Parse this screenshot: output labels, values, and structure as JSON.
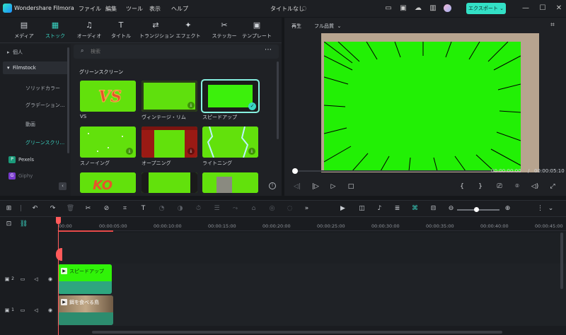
{
  "app": {
    "name": "Wondershare Filmora",
    "menu": [
      "ファイル",
      "編集",
      "ツール",
      "表示",
      "ヘルプ"
    ],
    "project_title": "タイトルなし",
    "export_label": "エクスポート",
    "accent": "#33e0c6"
  },
  "media": {
    "tabs": [
      {
        "label": "メディア",
        "icon": "media-icon"
      },
      {
        "label": "ストック",
        "icon": "stock-icon"
      },
      {
        "label": "オーディオ",
        "icon": "music-note-icon"
      },
      {
        "label": "タイトル",
        "icon": "title-icon"
      },
      {
        "label": "トランジション",
        "icon": "transition-icon"
      },
      {
        "label": "エフェクト",
        "icon": "effect-icon"
      },
      {
        "label": "ステッカー",
        "icon": "sticker-icon"
      },
      {
        "label": "テンプレート",
        "icon": "template-icon"
      }
    ],
    "sidebar": {
      "personal": "個人",
      "filmstock": "Filmstock",
      "sub_items": [
        "ソリッドカラー",
        "グラデーション...",
        "動画",
        "グリーンスクリ..."
      ],
      "pexels": "Pexels",
      "giphy": "Giphy"
    },
    "search_placeholder": "検索",
    "section_title": "グリーンスクリーン",
    "items": [
      {
        "label": "VS"
      },
      {
        "label": "ヴィンテージ・リム"
      },
      {
        "label": "スピードアップ"
      },
      {
        "label": "スノーイング"
      },
      {
        "label": "オープニング"
      },
      {
        "label": "ライトニング"
      },
      {
        "label": ""
      },
      {
        "label": ""
      },
      {
        "label": ""
      },
      {
        "label": ""
      }
    ]
  },
  "preview": {
    "label": "再生",
    "quality": "フル品質",
    "current_time": "00:00:00:00",
    "separator": "/",
    "total_time": "00:00:05:10"
  },
  "timeline": {
    "ruler": [
      "00:00",
      "00:00:05:00",
      "00:00:10:00",
      "00:00:15:00",
      "00:00:20:00",
      "00:00:25:00",
      "00:00:30:00",
      "00:00:35:00",
      "00:00:40:00",
      "00:00:45:00"
    ],
    "tracks": [
      {
        "index": "2",
        "clip_name": "スピードアップ",
        "clip_color": "#2ea67f"
      },
      {
        "index": "1",
        "clip_name": "餌を食べる鳥",
        "clip_color": "#2c8c6e"
      }
    ]
  }
}
